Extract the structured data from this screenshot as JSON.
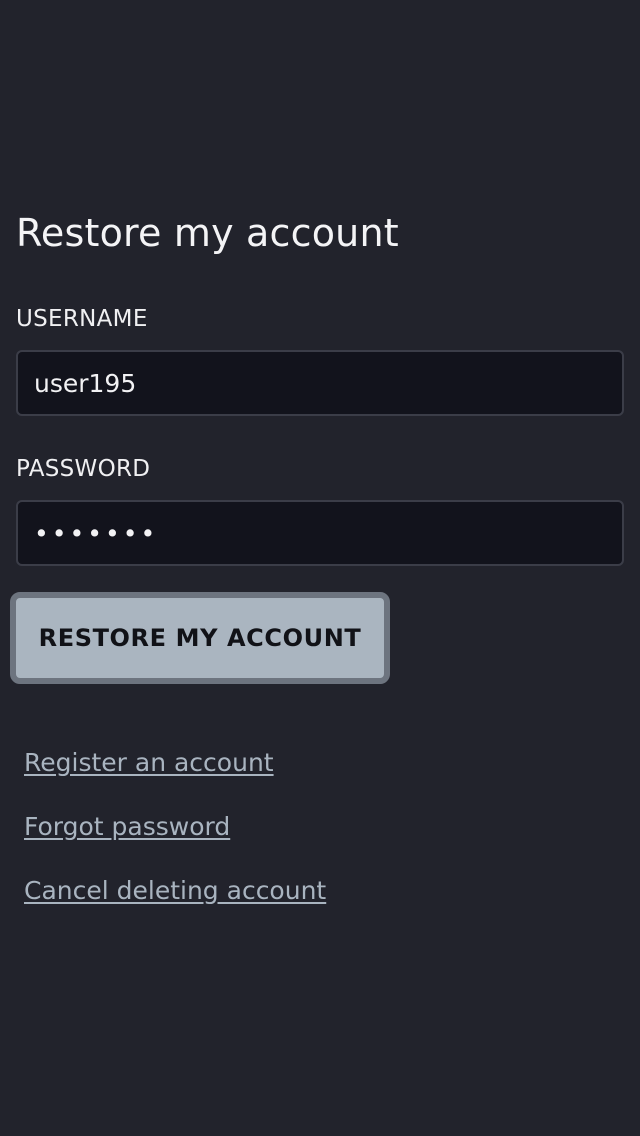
{
  "page": {
    "title": "Restore my account"
  },
  "form": {
    "username_label": "USERNAME",
    "username_value": "user195",
    "password_label": "PASSWORD",
    "password_value": "•••••••",
    "submit_label": "RESTORE MY ACCOUNT"
  },
  "links": {
    "register": "Register an account",
    "forgot_password": "Forgot password",
    "cancel_deleting": "Cancel deleting account"
  },
  "colors": {
    "background": "#22232c",
    "input_background": "#12131c",
    "button_background": "#aab5c0",
    "button_border": "#6d747f",
    "link": "#a9b4c0"
  }
}
